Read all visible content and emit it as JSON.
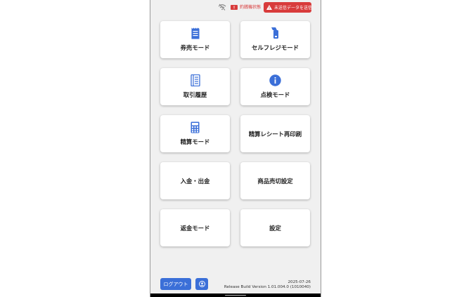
{
  "status_bar": {
    "printer_status": "釣銭機状態",
    "alert_label": "未送信データを送信",
    "colors": {
      "alert": "#d83b3b"
    }
  },
  "menu": {
    "ticket_sales": "券売モード",
    "self_register": "セルフレジモード",
    "transaction_history": "取引履歴",
    "inspection_mode": "点検モード",
    "settlement_mode": "精算モード",
    "reprint_receipt": "精算レシート再印刷",
    "deposit_withdraw": "入金・出金",
    "sold_out_settings": "商品売切設定",
    "refund_mode": "返金モード",
    "settings": "設定"
  },
  "icons": {
    "ticket_sales": "receipt-icon",
    "self_register": "handheld-scanner-icon",
    "transaction_history": "notebook-icon",
    "inspection_mode": "info-icon",
    "settlement_mode": "calculator-icon"
  },
  "footer": {
    "logout_label": "ログアウト",
    "date": "2025-07-26",
    "version": "Release Build Version 1.01.004.0 (1010040)"
  },
  "theme": {
    "accent": "#3b6fd8",
    "background": "#f0f0f0"
  }
}
